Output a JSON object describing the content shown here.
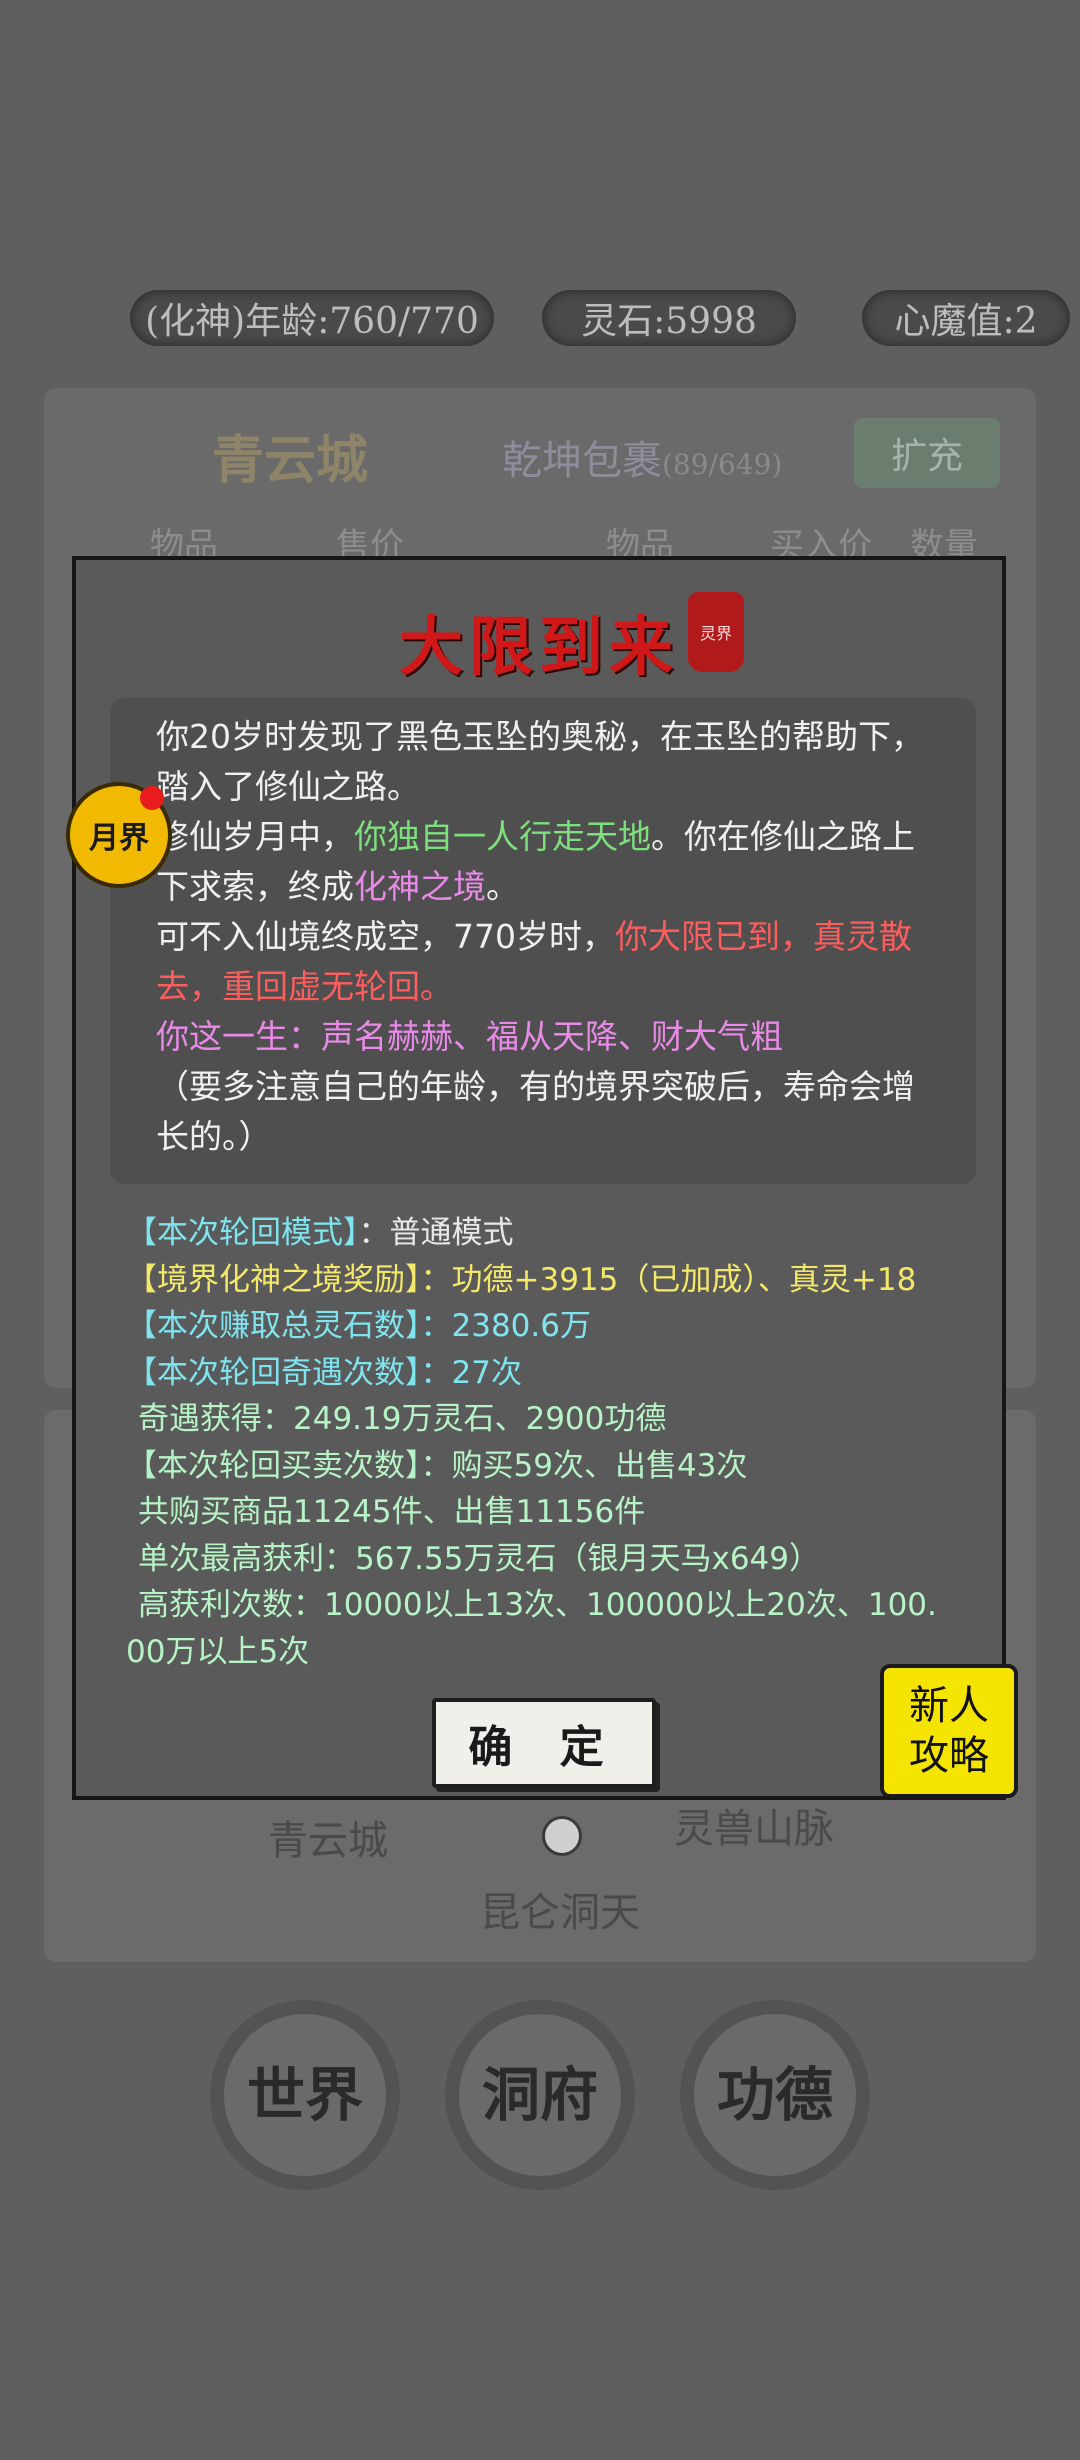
{
  "status": {
    "age": "(化神)年龄:760/770",
    "spirit_stones": "灵石:5998",
    "demon_value": "心魔值:2"
  },
  "shop": {
    "city": "青云城",
    "bag_title": "乾坤包裹",
    "bag_count": "(89/649)",
    "expand_label": "扩充",
    "headers": [
      "物品",
      "售价",
      "物品",
      "买入价",
      "数量"
    ]
  },
  "map": {
    "labels": [
      "青云城",
      "灵兽山脉",
      "昆仑洞天"
    ]
  },
  "nav": [
    "世界",
    "洞府",
    "功德"
  ],
  "modal": {
    "title": "大限到来",
    "seal_text": "灵界",
    "badge_text": "月界",
    "story": {
      "p1": "你20岁时发现了黑色玉坠的奥秘，在玉坠的帮助下，踏入了修仙之路。",
      "p2_a": "修仙岁月中，",
      "p2_b": "你独自一人行走天地",
      "p2_c": "。你在修仙之路上下求索，终成",
      "p2_d": "化神之境",
      "p2_e": "。",
      "p3_a": "可不入仙境终成空，770岁时，",
      "p3_b": "你大限已到，真灵散去，重回虚无轮回。",
      "p4": "你这一生：声名赫赫、福从天降、财大气粗",
      "p5": "（要多注意自己的年龄，有的境界突破后，寿命会增长的。）"
    },
    "stats": {
      "mode_label": "【本次轮回模式】",
      "mode_value": "：普通模式",
      "realm_label": "【境界化神之境奖励】",
      "realm_value": "：功德+3915（已加成）、真灵+18",
      "earn_label": "【本次赚取总灵石数】",
      "earn_value": "：2380.6万",
      "enc_label": "【本次轮回奇遇次数】",
      "enc_value": "：27次",
      "enc_detail": "奇遇获得：249.19万灵石、2900功德",
      "trade_label": "【本次轮回买卖次数】",
      "trade_value": "：购买59次、出售43次",
      "trade_items": "共购买商品11245件、出售11156件",
      "best_profit": "单次最高获利：567.55万灵石（银月天马x649）",
      "high_profit_1": "高获利次数：10000以上13次、100000以上20次、100.",
      "high_profit_2": "00万以上5次"
    },
    "confirm_label": "确 定",
    "guide_label": "新人\n攻略"
  }
}
